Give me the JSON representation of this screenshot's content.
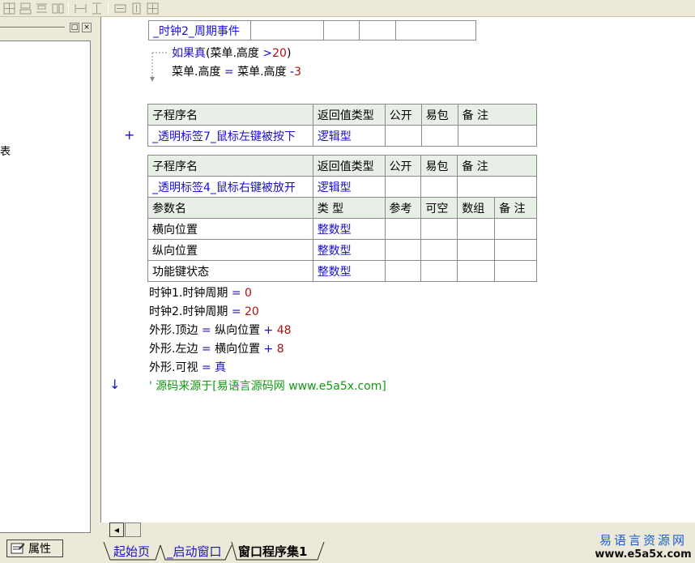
{
  "toolbar": {
    "icons": [
      "layout-icon-1",
      "layout-icon-2",
      "layout-icon-3",
      "layout-icon-4",
      "align-h-icon",
      "align-v-icon",
      "stretch-h-icon",
      "stretch-v-icon",
      "center-icon"
    ]
  },
  "left_panel": {
    "restore_glyph": "□",
    "close_glyph": "×",
    "tree_fragment": "表",
    "property_tab_label": "属性"
  },
  "editor": {
    "event_table": {
      "name": "_时钟2_周期事件"
    },
    "if_block": {
      "keyword": "如果真",
      "cond_open": "(菜单.高度 ",
      "cond_op": ">",
      "cond_num": "20",
      "cond_close": ")",
      "body_lhs": "菜单.高度 ",
      "body_eq": "=",
      "body_rhs": " 菜单.高度 ",
      "body_op": "-",
      "body_num": "3"
    },
    "sub1": {
      "headers": [
        "子程序名",
        "返回值类型",
        "公开",
        "易包",
        "备 注"
      ],
      "name": "_透明标签7_鼠标左键被按下",
      "return_type": "逻辑型",
      "expand_glyph": "+"
    },
    "sub2": {
      "headers": [
        "子程序名",
        "返回值类型",
        "公开",
        "易包",
        "备 注"
      ],
      "name": "_透明标签4_鼠标右键被放开",
      "return_type": "逻辑型",
      "param_headers": [
        "参数名",
        "类 型",
        "参考",
        "可空",
        "数组",
        "备 注"
      ],
      "params": [
        {
          "name": "横向位置",
          "type": "整数型"
        },
        {
          "name": "纵向位置",
          "type": "整数型"
        },
        {
          "name": "功能键状态",
          "type": "整数型"
        }
      ]
    },
    "lines": [
      {
        "lhs": "时钟1.时钟周期 ",
        "op": "=",
        "rhs": " ",
        "op2": "",
        "num": "0"
      },
      {
        "lhs": "时钟2.时钟周期 ",
        "op": "=",
        "rhs": " ",
        "op2": "",
        "num": "20"
      },
      {
        "lhs": "外形.顶边 ",
        "op": "=",
        "rhs": " 纵向位置 ",
        "op2": "+",
        "num": " 48"
      },
      {
        "lhs": "外形.左边 ",
        "op": "=",
        "rhs": " 横向位置 ",
        "op2": "+",
        "num": " 8"
      },
      {
        "lhs": "外形.可视 ",
        "op": "=",
        "rhs": " ",
        "op2": "",
        "num": "真"
      }
    ],
    "comment": "' 源码来源于[易语言源码网 www.e5a5x.com]",
    "arrow_glyph": "↓"
  },
  "bottom": {
    "scroll_left_glyph": "◂",
    "tabs": [
      {
        "label": "起始页",
        "active": false
      },
      {
        "label": "_启动窗口",
        "active": false
      },
      {
        "label": "窗口程序集1",
        "active": true
      }
    ]
  },
  "watermark": {
    "title": "易语言资源网",
    "url": "www.e5a5x.com"
  }
}
